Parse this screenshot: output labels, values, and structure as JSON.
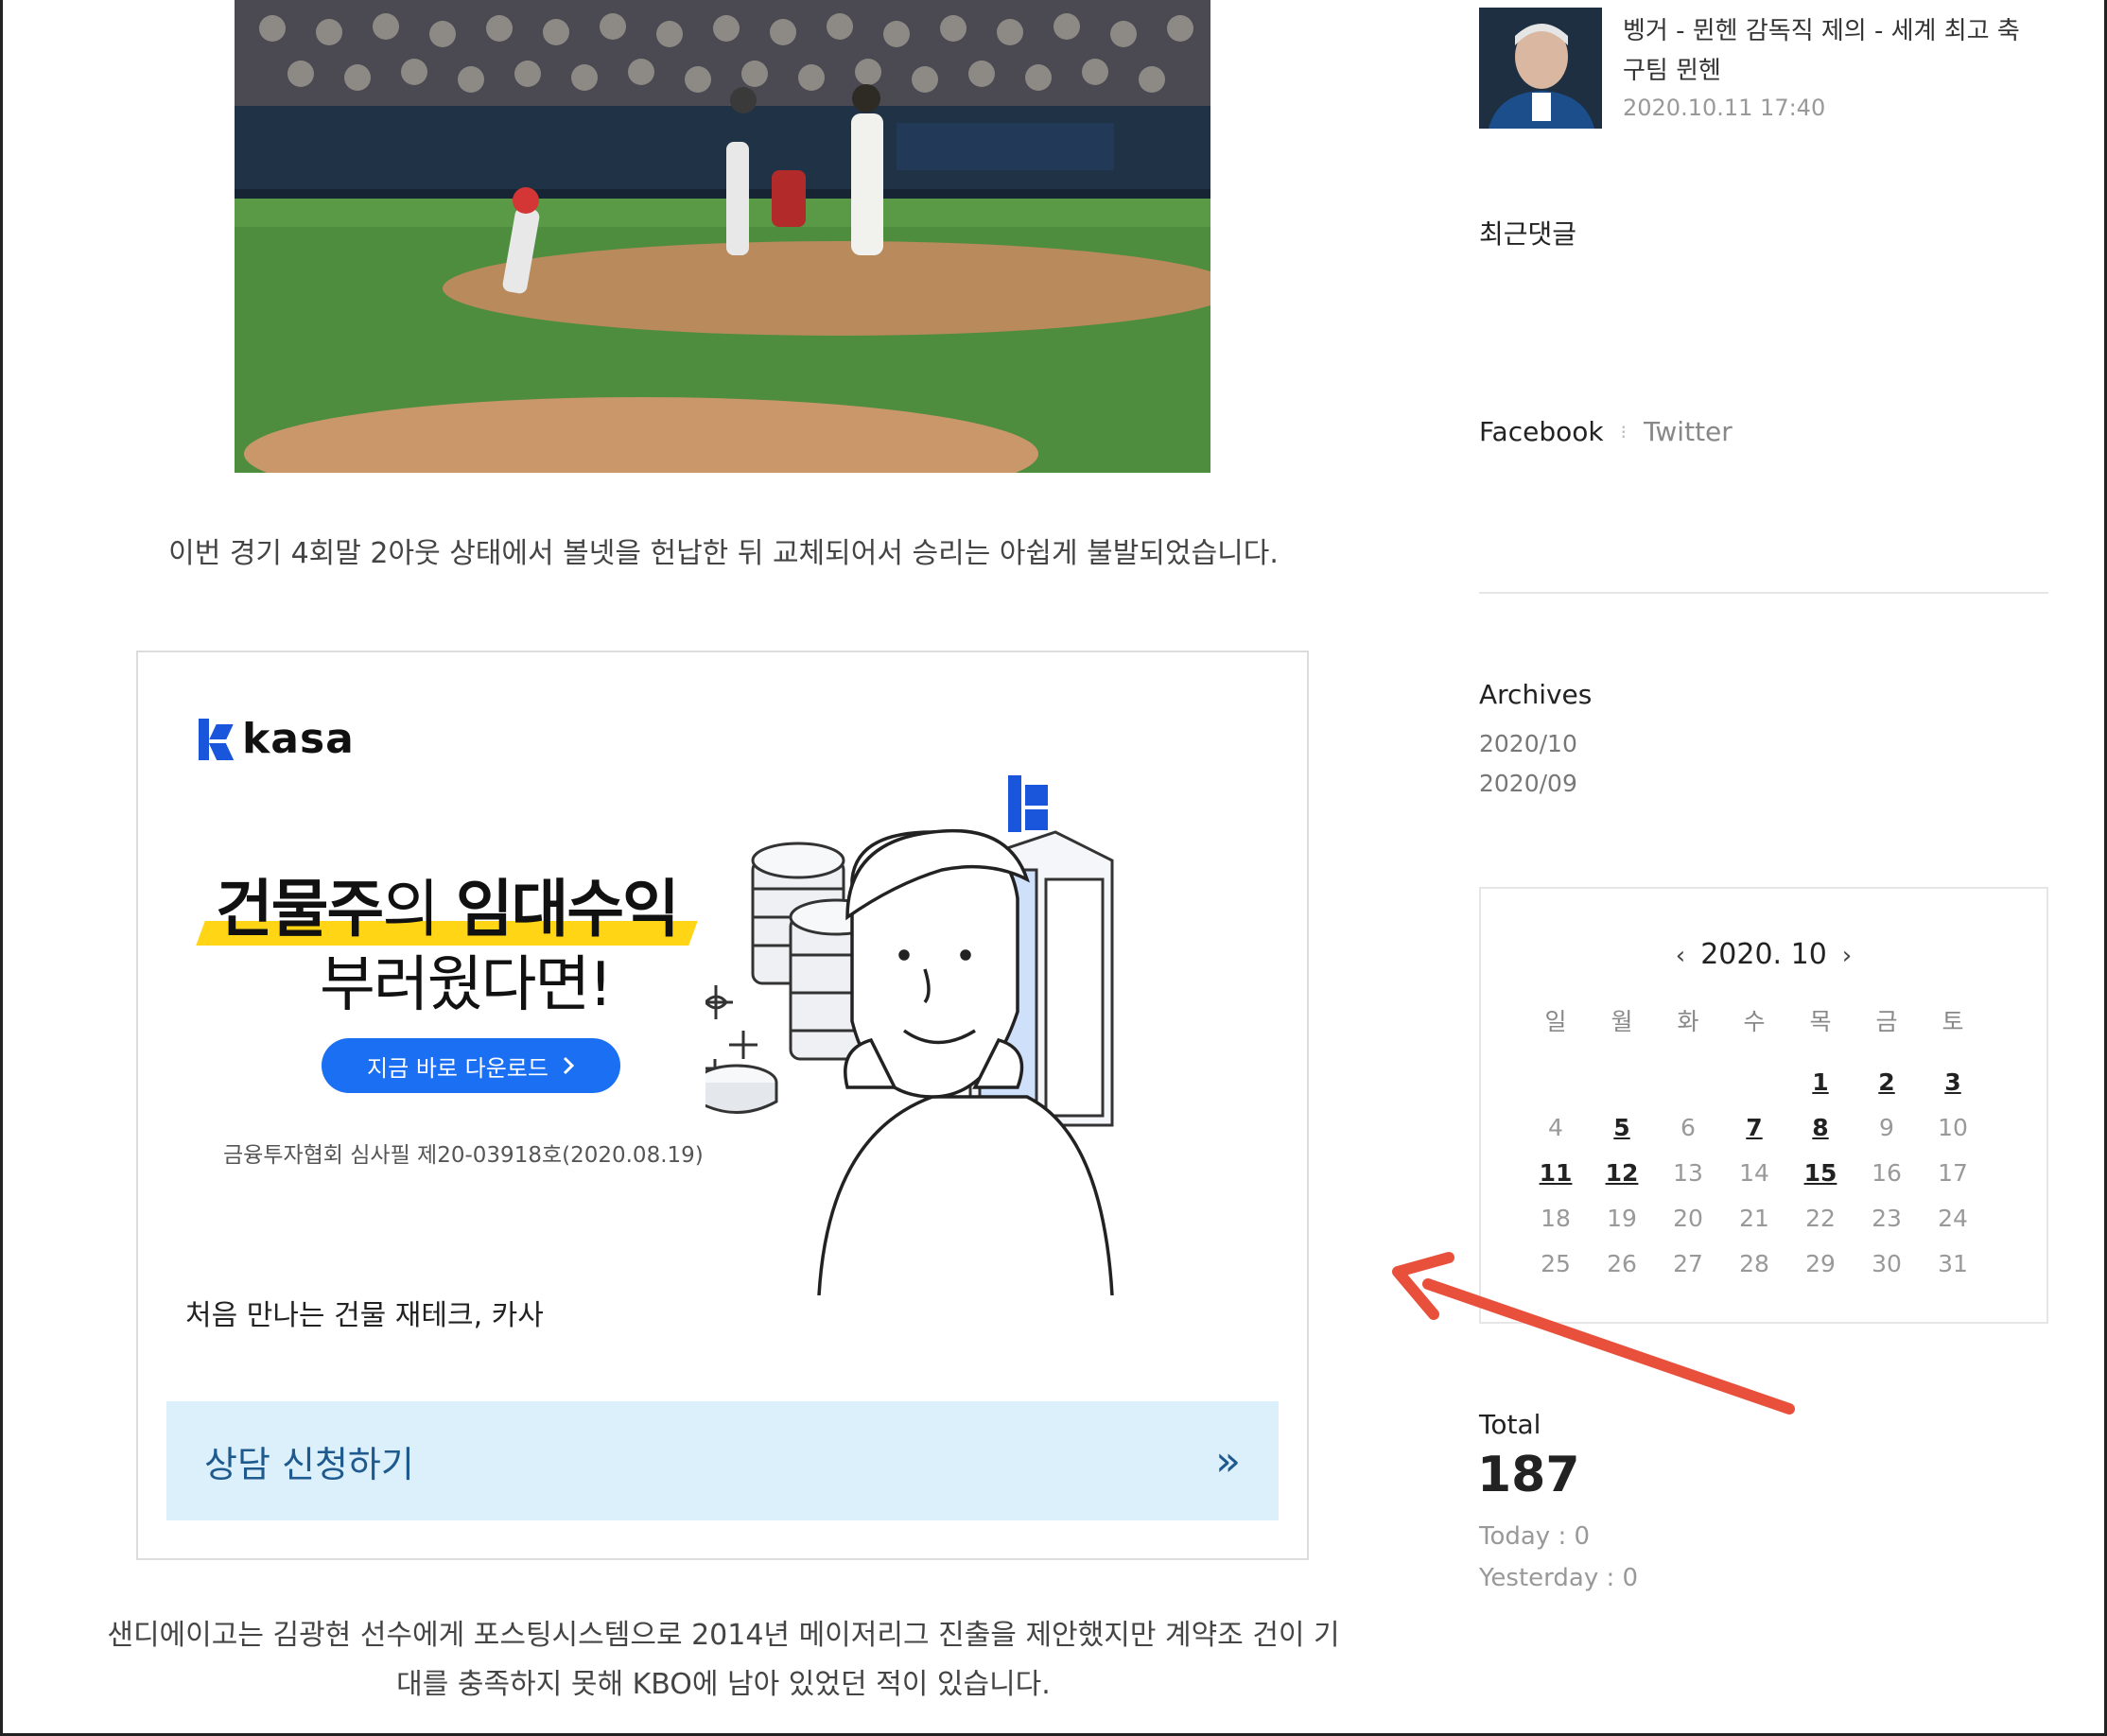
{
  "article": {
    "paragraph_1": "이번 경기 4회말 2아웃 상태에서 볼넷을 헌납한 뒤 교체되어서 승리는 아쉽게 불발되었습니다.",
    "paragraph_2": "샌디에이고는 김광현 선수에게 포스팅시스템으로 2014년 메이저리그 진출을 제안했지만 계약조 건이 기대를 충족하지 못해 KBO에 남아 있었던 적이 있습니다."
  },
  "ad": {
    "brand": "kasa",
    "headline_bold_1": "건물주",
    "headline_light": "의 ",
    "headline_bold_2": "임대수익",
    "headline_line2": "부러웠다면!",
    "download_label": "지금 바로 다운로드",
    "fine_print": "금융투자협회 심사필 제20-03918호(2020.08.19)",
    "subtitle": "처음 만나는 건물 재테크, 카사",
    "cta_label": "상담 신청하기",
    "cta_arrow": "»"
  },
  "sidebar": {
    "popular_post": {
      "title": "벵거 - 뮌헨 감독직 제의 - 세계 최고 축구팀 뮌헨",
      "date": "2020.10.11 17:40"
    },
    "recent_comments_title": "최근댓글",
    "social": {
      "facebook": "Facebook",
      "twitter": "Twitter",
      "separator": "⁝"
    },
    "archives": {
      "title": "Archives",
      "items": [
        "2020/10",
        "2020/09"
      ]
    },
    "calendar": {
      "prev": "‹",
      "next": "›",
      "month": "2020. 10",
      "weekdays": [
        "일",
        "월",
        "화",
        "수",
        "목",
        "금",
        "토"
      ],
      "weeks": [
        [
          "",
          "",
          "",
          "",
          "1",
          "2",
          "3"
        ],
        [
          "4",
          "5",
          "6",
          "7",
          "8",
          "9",
          "10"
        ],
        [
          "11",
          "12",
          "13",
          "14",
          "15",
          "16",
          "17"
        ],
        [
          "18",
          "19",
          "20",
          "21",
          "22",
          "23",
          "24"
        ],
        [
          "25",
          "26",
          "27",
          "28",
          "29",
          "30",
          "31"
        ]
      ],
      "linked_days": [
        "1",
        "2",
        "3",
        "5",
        "7",
        "8",
        "11",
        "12",
        "15"
      ]
    },
    "stats": {
      "total_title": "Total",
      "total_value": "187",
      "today": "Today : 0",
      "yesterday": "Yesterday : 0"
    }
  },
  "colors": {
    "accent_blue": "#1a6ff2",
    "highlight_yellow": "#ffd515",
    "cta_bg": "#dcf0fc",
    "annotation_arrow": "#e8503c"
  }
}
